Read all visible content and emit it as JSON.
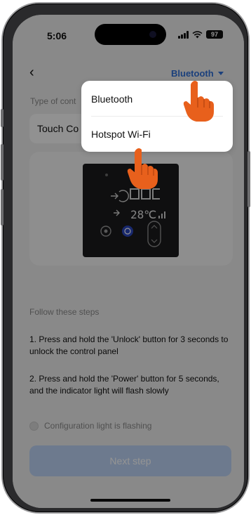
{
  "status_bar": {
    "time": "5:06",
    "battery": "97",
    "wifi_icon": "wifi-icon",
    "signal_icon": "signal-bars-icon"
  },
  "nav": {
    "back_icon": "chevron-left-icon",
    "back_glyph": "‹",
    "protocol_selected": "Bluetooth",
    "protocol_accent": "#2f6fd6"
  },
  "controller": {
    "label": "Type of cont",
    "value": "Touch Co"
  },
  "device": {
    "temperature_display": "28",
    "temperature_unit": "℃"
  },
  "steps": {
    "title": "Follow these steps",
    "step1": "1. Press and hold the 'Unlock' button for 3 seconds to unlock the control panel",
    "step2": "2. Press and hold the 'Power' button for 5 seconds, and the indicator light will flash slowly"
  },
  "confirm": {
    "label": "Configuration light is flashing"
  },
  "next_button": {
    "label": "Next step",
    "color": "#bcd3f5"
  },
  "dropdown": {
    "options": [
      "Bluetooth",
      "Hotspot Wi-Fi"
    ]
  },
  "annotations": {
    "hand_color": "#e8601c"
  }
}
